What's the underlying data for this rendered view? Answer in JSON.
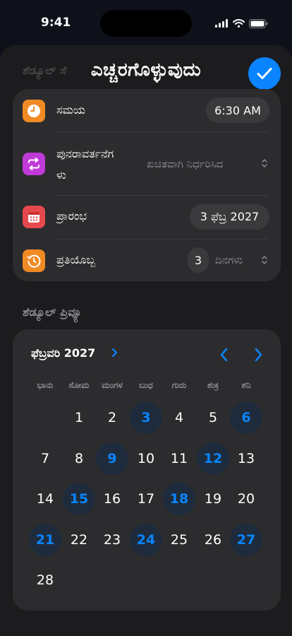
{
  "status_bar": {
    "time": "9:41"
  },
  "header": {
    "title": "ಎಚ್ಚರಗೊಳ್ಳುವುದು",
    "ghost_title": "ಶೆಡ್ಯೂಲ್ ಸೆ"
  },
  "settings": {
    "time": {
      "label": "ಸಮಯ",
      "value": "6:30 AM"
    },
    "recurrence": {
      "label_line1": "ಪುನರಾವರ್ತನೆಗ",
      "label_line2": "ಳು",
      "value": "ಖಚಿತವಾಗಿ ನಿರ್ಧರಿಸಿದ"
    },
    "start": {
      "label": "ಪ್ರಾರಂಭ",
      "value": "3 ಫೆಬ್ರ 2027"
    },
    "every": {
      "label": "ಪ್ರತಿಯೊಬ್ಬ",
      "count": "3",
      "unit": "ದಿನಗಳು"
    }
  },
  "preview": {
    "section_title": "ಶೆಡ್ಯೂಲ್ ಪ್ರಿವ್ಯೂ",
    "month_label": "ಫೆಬ್ರವರಿ 2027",
    "weekdays": [
      "ಭಾನು",
      "ಸೋಮ",
      "ಮಂಗಳ",
      "ಬುಧ",
      "ಗುರು",
      "ಶುಕ್ರ",
      "ಶನಿ"
    ],
    "first_weekday_index": 1,
    "days_in_month": 28,
    "highlighted_days": [
      3,
      6,
      9,
      12,
      15,
      18,
      21,
      24,
      27
    ]
  },
  "colors": {
    "accent": "#0a84ff",
    "card": "#2c2c2e",
    "sheet": "#1c1c1e"
  },
  "icons": {
    "time": "clock-icon",
    "recurrence": "repeat-icon",
    "start": "calendar-icon",
    "every": "history-icon"
  }
}
